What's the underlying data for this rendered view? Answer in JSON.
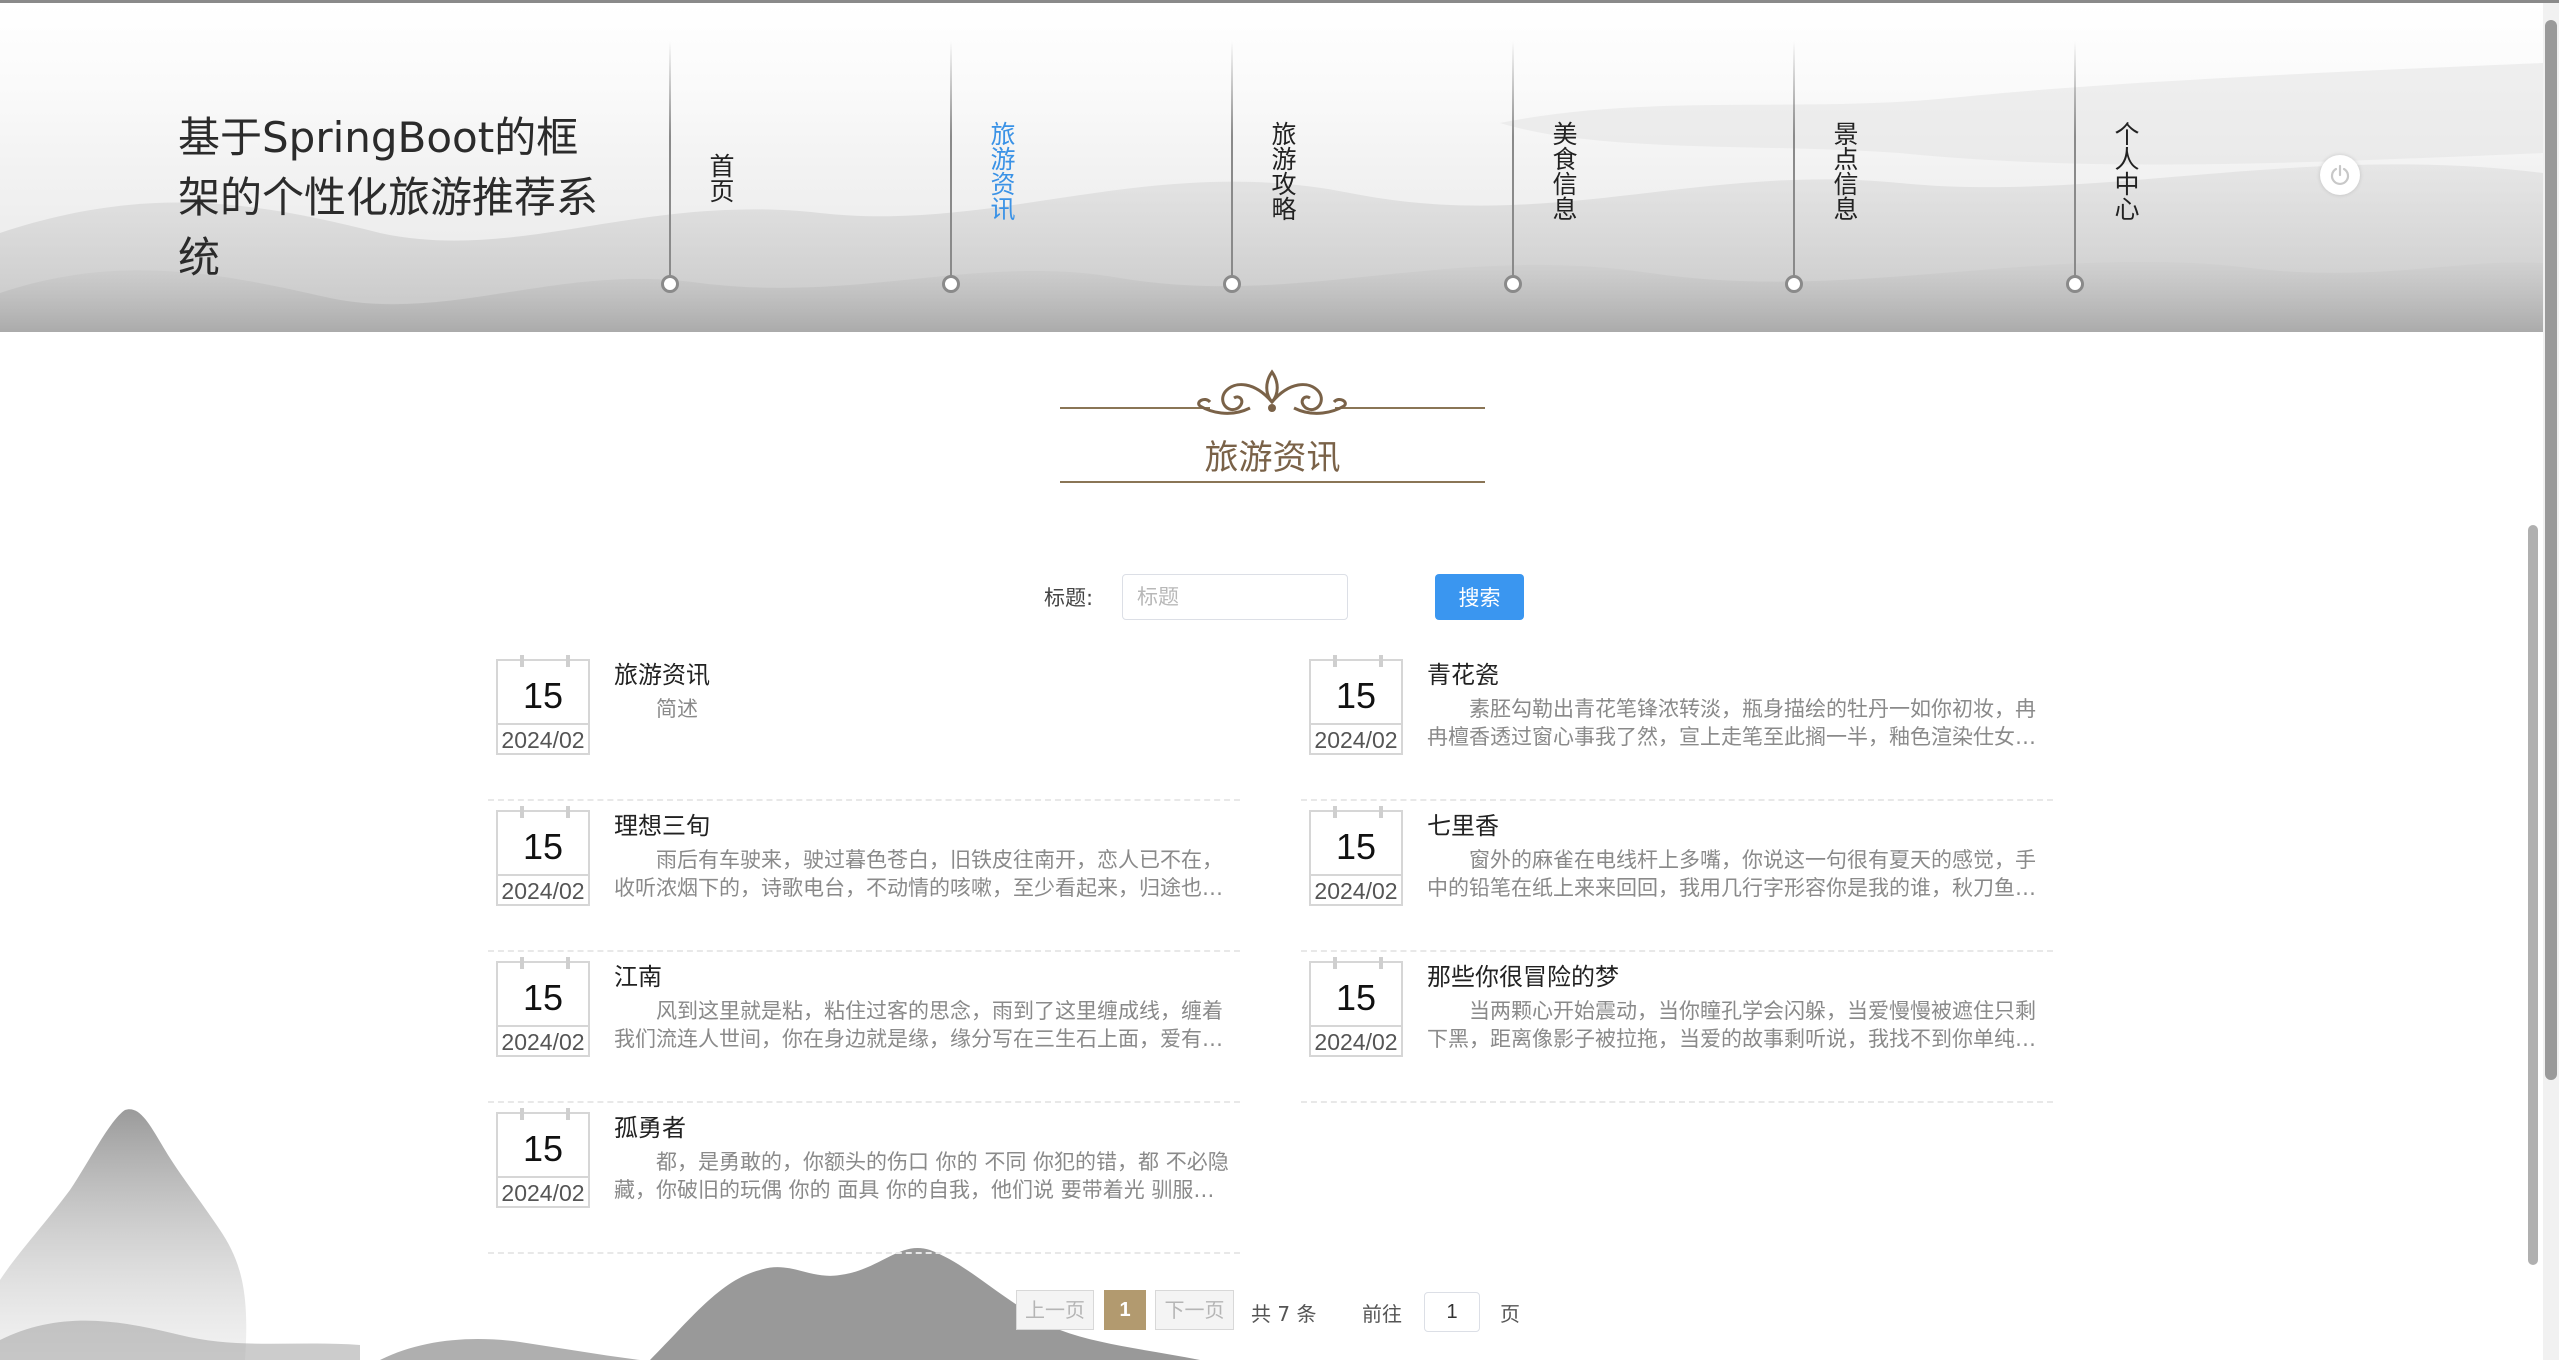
{
  "site": {
    "title": "基于SpringBoot的框架的个性化旅游推荐系统"
  },
  "nav": [
    {
      "label": "首页",
      "active": false
    },
    {
      "label": "旅游资讯",
      "active": true
    },
    {
      "label": "旅游攻略",
      "active": false
    },
    {
      "label": "美食信息",
      "active": false
    },
    {
      "label": "景点信息",
      "active": false
    },
    {
      "label": "个人中心",
      "active": false
    }
  ],
  "section": {
    "title": "旅游资讯"
  },
  "search": {
    "label": "标题:",
    "placeholder": "标题",
    "value": "",
    "button": "搜索"
  },
  "news": [
    {
      "day": "15",
      "ym": "2024/02",
      "title": "旅游资讯",
      "desc": "简述"
    },
    {
      "day": "15",
      "ym": "2024/02",
      "title": "青花瓷",
      "desc": "素胚勾勒出青花笔锋浓转淡，瓶身描绘的牡丹一如你初妆，冉冉檀香透过窗心事我了然，宣上走笔至此搁一半，釉色渲染仕女…"
    },
    {
      "day": "15",
      "ym": "2024/02",
      "title": "理想三旬",
      "desc": "雨后有车驶来，驶过暮色苍白，旧铁皮往南开，恋人已不在，收听浓烟下的，诗歌电台，不动情的咳嗽，至少看起来，归途也…"
    },
    {
      "day": "15",
      "ym": "2024/02",
      "title": "七里香",
      "desc": "窗外的麻雀在电线杆上多嘴，你说这一句很有夏天的感觉，手中的铅笔在纸上来来回回，我用几行字形容你是我的谁，秋刀鱼…"
    },
    {
      "day": "15",
      "ym": "2024/02",
      "title": "江南",
      "desc": "风到这里就是粘，粘住过客的思念，雨到了这里缠成线，缠着我们流连人世间，你在身边就是缘，缘分写在三生石上面，爱有…"
    },
    {
      "day": "15",
      "ym": "2024/02",
      "title": "那些你很冒险的梦",
      "desc": "当两颗心开始震动，当你瞳孔学会闪躲，当爱慢慢被遮住只剩下黑，距离像影子被拉拖，当爱的故事剩听说，我找不到你单纯…"
    },
    {
      "day": "15",
      "ym": "2024/02",
      "title": "孤勇者",
      "desc": "都，是勇敢的，你额头的伤口 你的 不同 你犯的错，都 不必隐藏，你破旧的玩偶 你的 面具 你的自我，他们说 要带着光 驯服每…"
    }
  ],
  "pagination": {
    "prev": "上一页",
    "current": "1",
    "next": "下一页",
    "total": "共 7 条",
    "goto_prefix": "前往",
    "goto_value": "1",
    "goto_suffix": "页"
  },
  "colors": {
    "accent": "#3a96f0",
    "active_nav": "#3a92e6",
    "pager_current": "#b29a6f",
    "heading": "#7a6248"
  },
  "icons": {
    "logout": "power-icon"
  }
}
